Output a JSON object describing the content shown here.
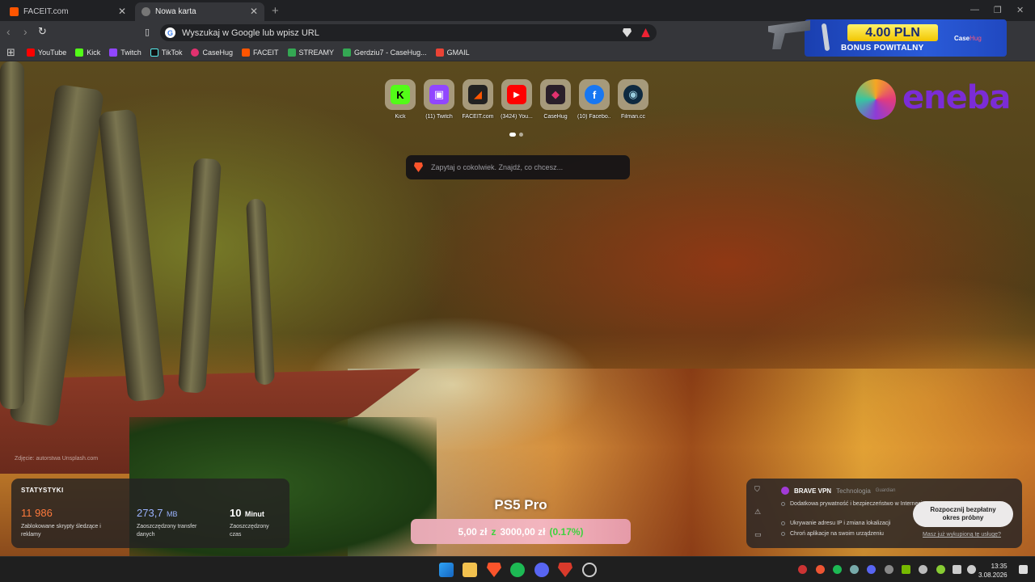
{
  "tabs": [
    {
      "title": "FACEIT.com"
    },
    {
      "title": "Nowa karta"
    }
  ],
  "address_bar": {
    "placeholder": "Wyszukaj w Google lub wpisz URL"
  },
  "bookmarks": [
    {
      "label": "YouTube",
      "color": "#ff0000"
    },
    {
      "label": "Kick",
      "color": "#53fc18"
    },
    {
      "label": "Twitch",
      "color": "#9146ff"
    },
    {
      "label": "TikTok",
      "color": "#111111"
    },
    {
      "label": "CaseHug",
      "color": "#e2316f"
    },
    {
      "label": "FACEIT",
      "color": "#ff5500"
    },
    {
      "label": "STREAMY",
      "color": "#34a853"
    },
    {
      "label": "Gerdziu7 - CaseHug...",
      "color": "#34a853"
    },
    {
      "label": "GMAIL",
      "color": "#ea4335"
    }
  ],
  "ad": {
    "price": "4.00 PLN",
    "bonus": "BONUS POWITALNY",
    "brand_a": "Case",
    "brand_b": "Hug"
  },
  "top_sites": [
    {
      "label": "Kick",
      "glyph": "K",
      "bg": "#53fc18",
      "fg": "#000"
    },
    {
      "label": "(11) Twitch",
      "glyph": "▣",
      "bg": "#9146ff",
      "fg": "#fff"
    },
    {
      "label": "FACEIT.com",
      "glyph": "◢",
      "bg": "#222",
      "fg": "#ff5500"
    },
    {
      "label": "(3424) You...",
      "glyph": "▶",
      "bg": "#ff0000",
      "fg": "#fff"
    },
    {
      "label": "CaseHug",
      "glyph": "◆",
      "bg": "#2a1f2a",
      "fg": "#e2316f"
    },
    {
      "label": "(10) Facebo...",
      "glyph": "f",
      "bg": "#1877f2",
      "fg": "#fff"
    },
    {
      "label": "Filman.cc",
      "glyph": "◉",
      "bg": "#0f2a40",
      "fg": "#9cd"
    }
  ],
  "search": {
    "placeholder": "Zapytaj o cokolwiek. Znajdź, co chcesz..."
  },
  "eneba": {
    "word": "eneba"
  },
  "photo_credit": "Zdjęcie: autorstwa Unsplash.com",
  "stats": {
    "title": "STATYSTYKI",
    "items": [
      {
        "value": "11 986",
        "unit": "",
        "desc": "Zablokowane skrypty śledzące i reklamy",
        "color": "#ff7a3c"
      },
      {
        "value": "273,7",
        "unit": "MB",
        "desc": "Zaoszczędzony transfer danych",
        "color": "#9bb3ff"
      },
      {
        "value": "10",
        "unit": "Minut",
        "desc": "Zaoszczędzony czas",
        "color": "#ffffff"
      }
    ]
  },
  "ps5": {
    "title": "PS5 Pro",
    "current": "5,00 zł",
    "z": "z",
    "target": "3000,00 zł",
    "pct": "(0.17%)"
  },
  "vpn": {
    "name": "BRAVE VPN",
    "tech": "Technologia",
    "guard": "Guardian",
    "items": [
      "Dodatkowa prywatność i bezpieczeństwo w Internecie",
      "Ukrywanie adresu IP i zmiana lokalizacji",
      "Chroń aplikacje na swoim urządzeniu"
    ],
    "cta": "Rozpocznij bezpłatny okres próbny",
    "link": "Masz już wykupioną tę usługę?"
  },
  "clock": {
    "time": "13:35",
    "date": "3.08.2026"
  }
}
